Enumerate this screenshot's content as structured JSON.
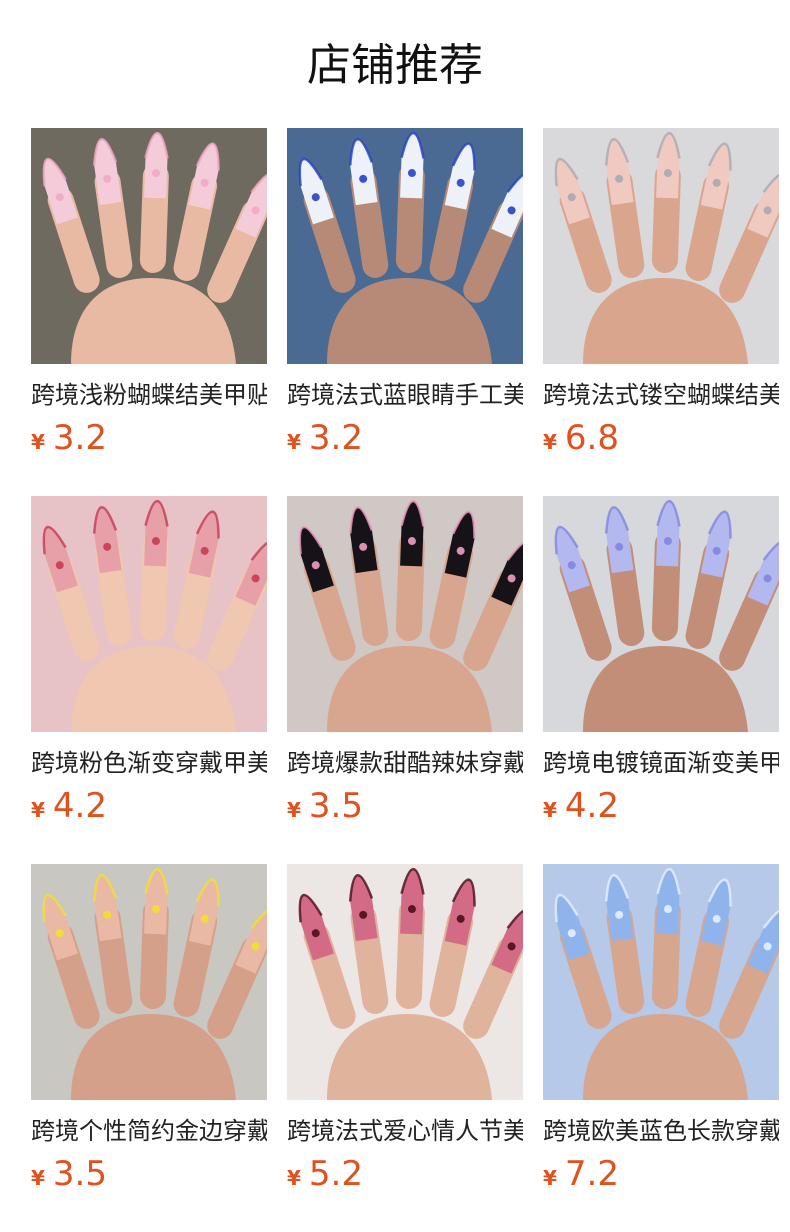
{
  "page": {
    "title": "店铺推荐",
    "accent_color": "#e1501d"
  },
  "products": [
    {
      "name": "跨境浅粉蝴蝶结美甲贴片",
      "currency": "¥",
      "price": "3.2",
      "image": {
        "bg": "#6f6a5f",
        "skin": "#e8b9a3",
        "nail": "#f4cbd8",
        "accent": "#f2a9c6"
      }
    },
    {
      "name": "跨境法式蓝眼睛手工美甲",
      "currency": "¥",
      "price": "3.2",
      "image": {
        "bg": "#4a6a93",
        "skin": "#b68a76",
        "nail": "#eef1f8",
        "accent": "#2340c8"
      }
    },
    {
      "name": "跨境法式镂空蝴蝶结美甲",
      "currency": "¥",
      "price": "6.8",
      "image": {
        "bg": "#d9d9db",
        "skin": "#d9a58c",
        "nail": "#f0c9c0",
        "accent": "#a9a9b0"
      }
    },
    {
      "name": "跨境粉色渐变穿戴甲美甲",
      "currency": "¥",
      "price": "4.2",
      "image": {
        "bg": "#e7c2c6",
        "skin": "#f0c7b0",
        "nail": "#e7a0a8",
        "accent": "#c73a52"
      }
    },
    {
      "name": "跨境爆款甜酷辣妹穿戴甲",
      "currency": "¥",
      "price": "3.5",
      "image": {
        "bg": "#cfc8c4",
        "skin": "#d8a58f",
        "nail": "#151218",
        "accent": "#f29ec2"
      }
    },
    {
      "name": "跨境电镀镜面渐变美甲片",
      "currency": "¥",
      "price": "4.2",
      "image": {
        "bg": "#d6d8dc",
        "skin": "#c38e78",
        "nail": "#b3b8ef",
        "accent": "#7f86df"
      }
    },
    {
      "name": "跨境个性简约金边穿戴甲",
      "currency": "¥",
      "price": "3.5",
      "image": {
        "bg": "#c9c7c2",
        "skin": "#d4a089",
        "nail": "#e9b9a6",
        "accent": "#f2e12a"
      }
    },
    {
      "name": "跨境法式爱心情人节美甲",
      "currency": "¥",
      "price": "5.2",
      "image": {
        "bg": "#ece6e4",
        "skin": "#e0b39c",
        "nail": "#d36b86",
        "accent": "#4a0f18"
      }
    },
    {
      "name": "跨境欧美蓝色长款穿戴甲",
      "currency": "¥",
      "price": "7.2",
      "image": {
        "bg": "#b7c9e8",
        "skin": "#d7a68f",
        "nail": "#8fb4ec",
        "accent": "#e6f0ff"
      }
    }
  ]
}
